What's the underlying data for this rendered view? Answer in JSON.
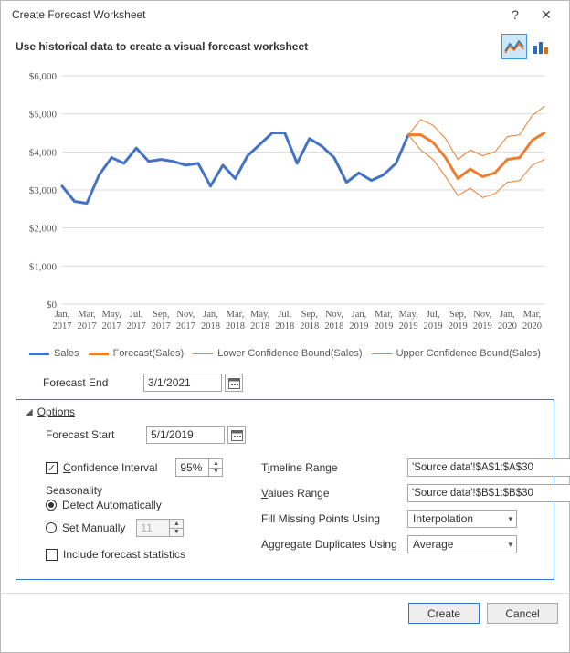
{
  "dialog": {
    "title": "Create Forecast Worksheet",
    "subtitle": "Use historical data to create a visual forecast worksheet",
    "help_label": "?",
    "close_label": "✕"
  },
  "chart_types": {
    "line_active": true
  },
  "chart_data": {
    "type": "line",
    "ylim": [
      0,
      6000
    ],
    "yticks": [
      0,
      1000,
      2000,
      3000,
      4000,
      5000,
      6000
    ],
    "ytick_labels": [
      "$0",
      "$1,000",
      "$2,000",
      "$3,000",
      "$4,000",
      "$5,000",
      "$6,000"
    ],
    "x_labels_top": [
      "Jan,",
      "Mar,",
      "May,",
      "Jul,",
      "Sep,",
      "Nov,",
      "Jan,",
      "Mar,",
      "May,",
      "Jul,",
      "Sep,",
      "Nov,",
      "Jan,",
      "Mar,",
      "May,",
      "Jul,",
      "Sep,",
      "Nov,",
      "Jan,",
      "Mar,"
    ],
    "x_labels_bottom": [
      "2017",
      "2017",
      "2017",
      "2017",
      "2017",
      "2017",
      "2018",
      "2018",
      "2018",
      "2018",
      "2018",
      "2018",
      "2019",
      "2019",
      "2019",
      "2019",
      "2019",
      "2019",
      "2020",
      "2020"
    ],
    "series": [
      {
        "name": "Sales",
        "color": "#4472c4",
        "width": 3,
        "x": [
          0,
          1,
          2,
          3,
          4,
          5,
          6,
          7,
          8,
          9,
          10,
          11,
          12,
          13,
          14,
          15,
          16,
          17,
          18,
          19,
          20,
          21,
          22,
          23,
          24,
          25,
          26,
          27,
          28
        ],
        "y": [
          3100,
          2700,
          2650,
          3400,
          3850,
          3700,
          4100,
          3750,
          3800,
          3750,
          3650,
          3700,
          3100,
          3650,
          3300,
          3900,
          4200,
          4500,
          4500,
          3700,
          4350,
          4150,
          3850,
          3200,
          3450,
          3250,
          3400,
          3700,
          4450
        ]
      },
      {
        "name": "Forecast(Sales)",
        "color": "#ed7d31",
        "width": 3,
        "x": [
          28,
          29,
          30,
          31,
          32,
          33,
          34,
          35,
          36,
          37,
          38,
          39
        ],
        "y": [
          4450,
          4450,
          4250,
          3850,
          3300,
          3550,
          3350,
          3450,
          3800,
          3850,
          4300,
          4500
        ]
      },
      {
        "name": "Lower Confidence Bound(Sales)",
        "color": "#ed7d31",
        "width": 1,
        "x": [
          28,
          29,
          30,
          31,
          32,
          33,
          34,
          35,
          36,
          37,
          38,
          39
        ],
        "y": [
          4450,
          4050,
          3800,
          3350,
          2850,
          3050,
          2800,
          2900,
          3200,
          3250,
          3650,
          3800
        ]
      },
      {
        "name": "Upper Confidence Bound(Sales)",
        "color": "#ed7d31",
        "width": 1,
        "x": [
          28,
          29,
          30,
          31,
          32,
          33,
          34,
          35,
          36,
          37,
          38,
          39
        ],
        "y": [
          4450,
          4850,
          4700,
          4350,
          3800,
          4050,
          3900,
          4000,
          4400,
          4450,
          4950,
          5200
        ]
      }
    ]
  },
  "legend": {
    "sales": "Sales",
    "forecast": "Forecast(Sales)",
    "lower": "Lower Confidence Bound(Sales)",
    "upper": "Upper Confidence Bound(Sales)"
  },
  "form": {
    "forecast_end_label": "Forecast End",
    "forecast_end_value": "3/1/2021",
    "options_label": "Options",
    "forecast_start_label": "Forecast Start",
    "forecast_start_value": "5/1/2019",
    "ci_label": "Confidence Interval",
    "ci_value": "95%",
    "seasonality_label": "Seasonality",
    "detect_auto_label": "Detect Automatically",
    "set_manually_label": "Set Manually",
    "set_manually_value": "11",
    "include_stats_label": "Include forecast statistics",
    "timeline_label_pre": "T",
    "timeline_label_u": "i",
    "timeline_label_post": "meline Range",
    "timeline_value": "'Source data'!$A$1:$A$30",
    "values_label_pre": "",
    "values_label_u": "V",
    "values_label_post": "alues Range",
    "values_value": "'Source data'!$B$1:$B$30",
    "fill_label": "Fill Missing Points Using",
    "fill_value": "Interpolation",
    "agg_label": "Aggregate Duplicates Using",
    "agg_value": "Average"
  },
  "buttons": {
    "create": "Create",
    "cancel": "Cancel"
  }
}
